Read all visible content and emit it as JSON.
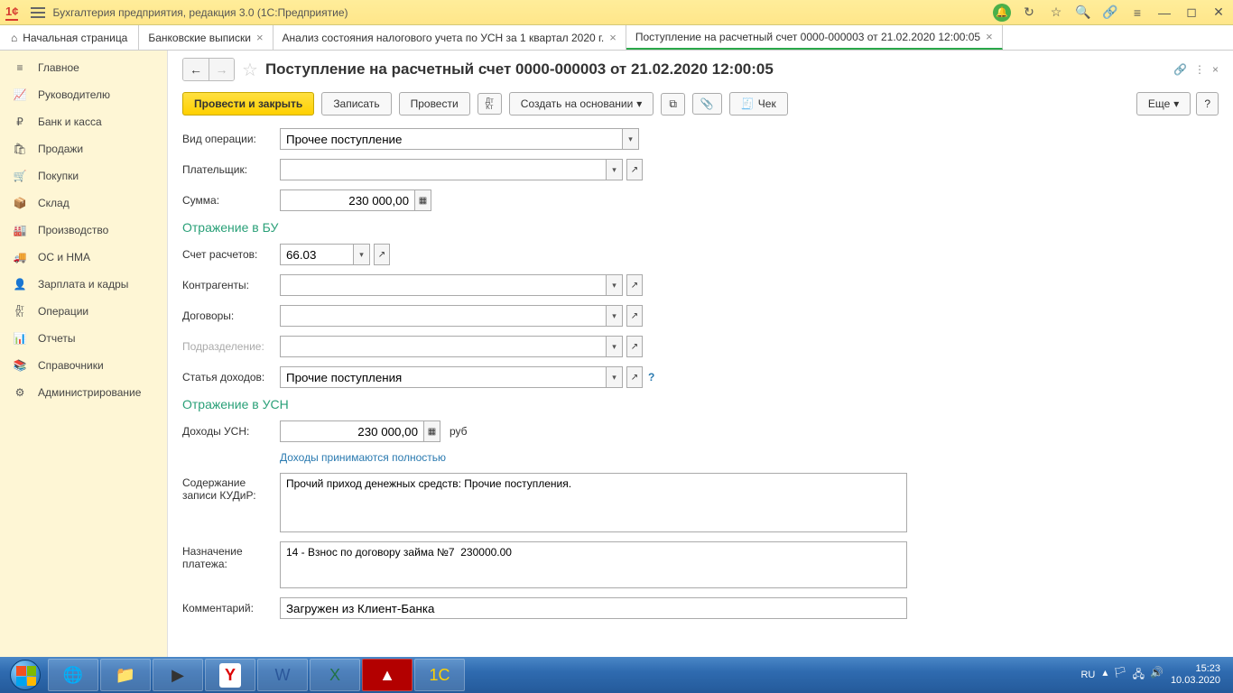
{
  "title_bar": {
    "app_title": "Бухгалтерия предприятия, редакция 3.0  (1С:Предприятие)"
  },
  "tabs": {
    "home": "Начальная страница",
    "t1": "Банковские выписки",
    "t2": "Анализ состояния налогового учета по УСН за 1 квартал 2020 г.",
    "t3": "Поступление на расчетный счет 0000-000003 от 21.02.2020 12:00:05"
  },
  "sidebar": {
    "items": [
      "Главное",
      "Руководителю",
      "Банк и касса",
      "Продажи",
      "Покупки",
      "Склад",
      "Производство",
      "ОС и НМА",
      "Зарплата и кадры",
      "Операции",
      "Отчеты",
      "Справочники",
      "Администрирование"
    ]
  },
  "doc": {
    "title": "Поступление на расчетный счет 0000-000003 от 21.02.2020 12:00:05",
    "btn_post_close": "Провести и закрыть",
    "btn_save": "Записать",
    "btn_post": "Провести",
    "btn_create_based": "Создать на основании",
    "btn_check": "Чек",
    "btn_more": "Еще",
    "labels": {
      "op_type": "Вид операции:",
      "payer": "Плательщик:",
      "amount": "Сумма:",
      "section_bu": "Отражение в БУ",
      "account": "Счет расчетов:",
      "counterparties": "Контрагенты:",
      "contracts": "Договоры:",
      "department": "Подразделение:",
      "income_item": "Статья доходов:",
      "section_usn": "Отражение в УСН",
      "usn_income": "Доходы УСН:",
      "currency": "руб",
      "income_full": "Доходы принимаются полностью",
      "kudir_content": "Содержание записи КУДиР:",
      "payment_purpose": "Назначение платежа:",
      "comment": "Комментарий:"
    },
    "values": {
      "op_type": "Прочее поступление",
      "amount": "230 000,00",
      "account": "66.03",
      "income_item": "Прочие поступления",
      "usn_income": "230 000,00",
      "kudir_content": "Прочий приход денежных средств: Прочие поступления.",
      "payment_purpose": "14 - Взнос по договору займа №7  230000.00",
      "comment": "Загружен из Клиент-Банка"
    }
  },
  "taskbar": {
    "lang": "RU",
    "time": "15:23",
    "date": "10.03.2020"
  }
}
